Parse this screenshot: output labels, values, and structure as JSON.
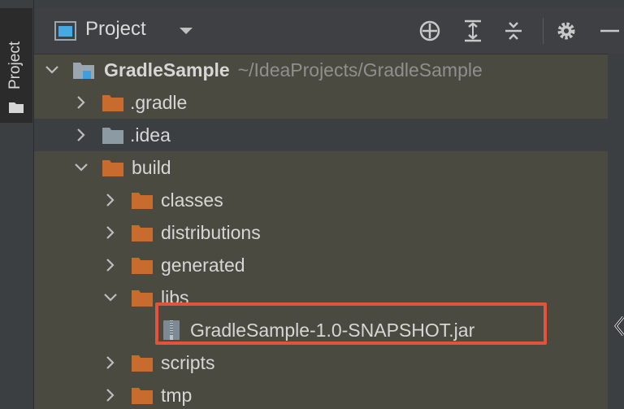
{
  "stripe": {
    "label": "Project"
  },
  "header": {
    "title": "Project"
  },
  "tree": {
    "root": {
      "label": "GradleSample",
      "path": "~/IdeaProjects/GradleSample"
    },
    "items": [
      {
        "label": ".gradle"
      },
      {
        "label": ".idea"
      },
      {
        "label": "build"
      },
      {
        "label": "classes"
      },
      {
        "label": "distributions"
      },
      {
        "label": "generated"
      },
      {
        "label": "libs"
      },
      {
        "label": "GradleSample-1.0-SNAPSHOT.jar"
      },
      {
        "label": "scripts"
      },
      {
        "label": "tmp"
      }
    ]
  },
  "colors": {
    "folder": "#c76b2e",
    "idea_folder": "#8c9aa3",
    "highlight": "#e2523e",
    "panel_bg": "#4b4a41",
    "selected_bg": "#3c3f41"
  }
}
